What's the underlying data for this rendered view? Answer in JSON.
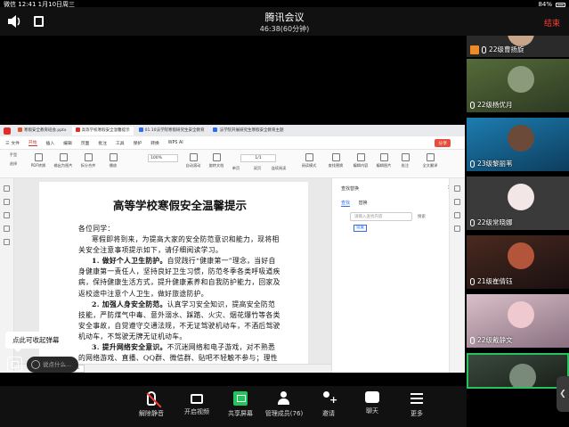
{
  "status_bar": {
    "carrier": "微信",
    "time": "12:41",
    "date": "1月10日周三",
    "battery": "84%"
  },
  "meeting": {
    "title": "腾讯会议",
    "duration": "46:38(60分钟)",
    "end_label": "结束"
  },
  "wps": {
    "tabs": [
      {
        "label": "寒假安全教育班会.pptx",
        "color": "#e0552b"
      },
      {
        "label": "高等学校寒假安全温馨提示",
        "color": "#e02b2b"
      },
      {
        "label": "01.10法学院寒假研究生安全教育",
        "color": "#2f6cf0"
      },
      {
        "label": "法学院开展研究生寒假安全教育主题",
        "color": "#2f6cf0"
      }
    ],
    "menu": [
      "三 文件",
      "开始",
      "插入",
      "编辑",
      "页面",
      "批注",
      "工具",
      "保护",
      "转换",
      "WPS AI"
    ],
    "menu_right": "分享",
    "toolbar": [
      {
        "label": "手型",
        "x": 0
      },
      {
        "label": "选择",
        "x": 0
      },
      {
        "label": "PDF转换",
        "x": 0
      },
      {
        "label": "输出为图片",
        "x": 0
      },
      {
        "label": "拆分合并",
        "x": 0
      },
      {
        "label": "播放",
        "x": 0
      },
      {
        "label": "自动滚动",
        "x": 0
      },
      {
        "label": "旋转文档",
        "x": 0
      },
      {
        "label": "单页",
        "x": 0
      },
      {
        "label": "双页",
        "x": 0
      },
      {
        "label": "连续阅读",
        "x": 0
      },
      {
        "label": "阅读模式",
        "x": 0
      },
      {
        "label": "查找替换",
        "x": 0
      },
      {
        "label": "编辑内容",
        "x": 0
      },
      {
        "label": "编辑图片",
        "x": 0
      },
      {
        "label": "批注",
        "x": 0
      },
      {
        "label": "全文翻译",
        "x": 0
      }
    ],
    "zoom": "100%",
    "page_indicator": "1/1",
    "status_page": "1/1",
    "search_panel": {
      "title": "查找替换",
      "tab_find": "查找",
      "tab_replace": "替换",
      "placeholder": "请输入查找内容",
      "go": "搜索",
      "option": "设置"
    }
  },
  "document": {
    "title": "高等学校寒假安全温馨提示",
    "greeting": "各位同学：",
    "p1": "寒假即将到来，为提高大家的安全防范意识和能力，现将相关安全注意事项提示如下，请仔细阅读学习。",
    "h1": "1. 做好个人卫生防护。",
    "p2": "自觉践行“健康第一”理念，当好自身健康第一责任人，坚持良好卫生习惯，防范冬季各类呼吸道疾病，保持健康生活方式，提升健康素养和自我防护能力，回家及返校途中注意个人卫生，做好旅途防护。",
    "h2": "2. 加强人身安全防范。",
    "p3": "认真学习安全知识，提高安全防范技能，严防煤气中毒、意外溺水、踩踏、火灾、烟花爆竹等各类安全事故，自觉遵守交通法规，不无证驾驶机动车，不酒后驾驶机动车，不驾驶无牌无证机动车。",
    "h3": "3. 提升网络安全意识。",
    "p4": "不沉迷网络和电子游戏，对不熟悉的网络游戏、直播、QQ群、微信群、贴吧不轻触不参与；理性表达"
  },
  "overlay": {
    "tooltip": "点此可收起弹幕",
    "chat_placeholder": "说点什么..."
  },
  "bottom_bar": [
    {
      "label": "解除静音",
      "icon": "mic-muted-icon"
    },
    {
      "label": "开启视频",
      "icon": "camera-icon"
    },
    {
      "label": "共享屏幕",
      "icon": "share-screen-icon"
    },
    {
      "label": "管理成员(76)",
      "icon": "members-icon"
    },
    {
      "label": "邀请",
      "icon": "invite-icon"
    },
    {
      "label": "聊天",
      "icon": "chat-icon"
    },
    {
      "label": "更多",
      "icon": "more-icon"
    }
  ],
  "participants": [
    {
      "name": "22级曹扬旋"
    },
    {
      "name": "22级杨优月"
    },
    {
      "name": "23级黎丽苇"
    },
    {
      "name": "22级常晓娜"
    },
    {
      "name": "21级崔倩钰"
    },
    {
      "name": "22级戴静文"
    },
    {
      "name": ""
    }
  ]
}
